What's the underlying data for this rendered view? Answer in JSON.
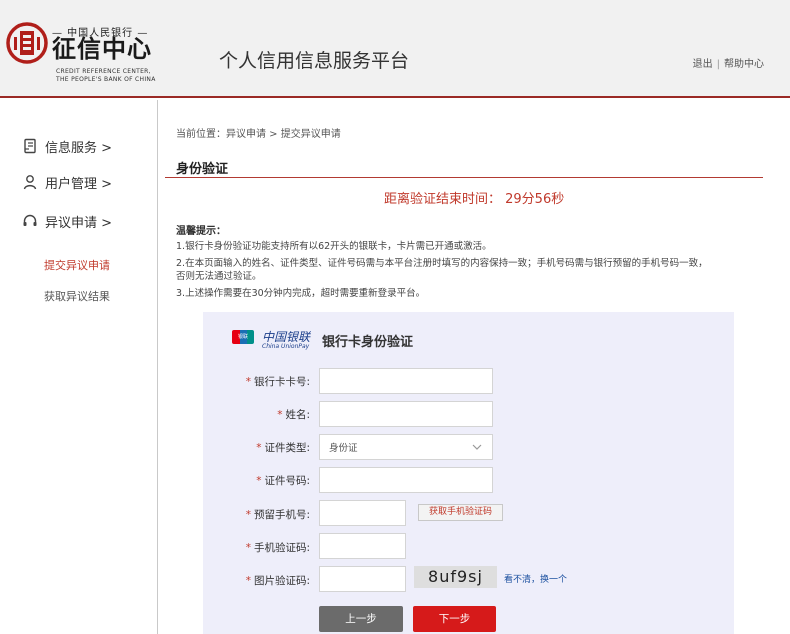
{
  "header": {
    "logo_top": "— 中国人民银行 —",
    "logo_name": "征信中心",
    "logo_en_line1": "CREDIT REFERENCE CENTER,",
    "logo_en_line2": "THE PEOPLE'S BANK OF CHINA",
    "site_title": "个人信用信息服务平台",
    "logout": "退出",
    "separator": "|",
    "help": "帮助中心",
    "accent_color": "#9b2a25"
  },
  "sidebar": {
    "items": [
      {
        "label": "信息服务 >",
        "icon": "document-icon"
      },
      {
        "label": "用户管理 >",
        "icon": "user-icon"
      },
      {
        "label": "异议申请 >",
        "icon": "headset-icon"
      }
    ],
    "sub_items": [
      {
        "label": "提交异议申请",
        "active": true
      },
      {
        "label": "获取异议结果",
        "active": false
      }
    ],
    "active_color": "#c0392b"
  },
  "main": {
    "breadcrumb": "当前位置：异议申请 > 提交异议申请",
    "section_title": "身份验证",
    "countdown": "距离验证结束时间： 29分56秒",
    "tips_title": "温馨提示：",
    "tips": [
      "1.银行卡身份验证功能支持所有以62开头的银联卡，卡片需已开通或激活。",
      "2.在本页面输入的姓名、证件类型、证件号码需与本平台注册时填写的内容保持一致；手机号码需与银行预留的手机号码一致，",
      "否则无法通过验证。",
      "3.上述操作需要在30分钟内完成，超时需要重新登录平台。"
    ]
  },
  "panel": {
    "unionpay_badge": "银联",
    "unionpay_cn": "中国银联",
    "unionpay_en": "China UnionPay",
    "title": "银行卡身份验证",
    "background": "#eeeefa",
    "fields": {
      "card_number": {
        "label": "银行卡卡号:",
        "value": ""
      },
      "name": {
        "label": "姓名:",
        "value": ""
      },
      "id_type": {
        "label": "证件类型:",
        "value": "身份证"
      },
      "id_number": {
        "label": "证件号码:",
        "value": ""
      },
      "phone": {
        "label": "预留手机号:",
        "value": ""
      },
      "sms_code": {
        "label": "手机验证码:",
        "value": ""
      },
      "captcha": {
        "label": "图片验证码:",
        "value": ""
      }
    },
    "required_mark": "*",
    "sms_button": "获取手机验证码",
    "captcha_text": "8uf9sj",
    "captcha_refresh": "看不清，换一个",
    "prev_button": "上一步",
    "next_button": "下一步"
  }
}
